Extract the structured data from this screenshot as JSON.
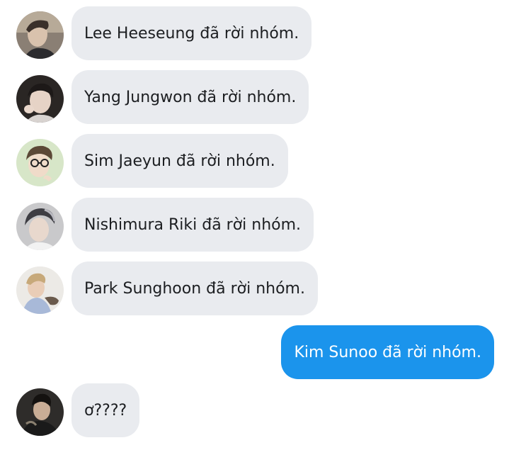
{
  "messages": [
    {
      "sender": "Lee Heeseung",
      "text": "Lee Heeseung đã rời nhóm.",
      "direction": "incoming"
    },
    {
      "sender": "Yang Jungwon",
      "text": "Yang Jungwon đã rời nhóm.",
      "direction": "incoming"
    },
    {
      "sender": "Sim Jaeyun",
      "text": "Sim Jaeyun đã rời nhóm.",
      "direction": "incoming"
    },
    {
      "sender": "Nishimura Riki",
      "text": "Nishimura Riki đã rời nhóm.",
      "direction": "incoming"
    },
    {
      "sender": "Park Sunghoon",
      "text": "Park Sunghoon đã rời nhóm.",
      "direction": "incoming"
    },
    {
      "sender": "Kim Sunoo",
      "text": "Kim Sunoo đã rời nhóm.",
      "direction": "outgoing"
    },
    {
      "sender": "",
      "text": "ơ????",
      "direction": "incoming"
    }
  ],
  "colors": {
    "incoming_bubble": "#e9ebef",
    "outgoing_bubble": "#1b94ec",
    "incoming_text": "#1c1e21",
    "outgoing_text": "#ffffff"
  }
}
